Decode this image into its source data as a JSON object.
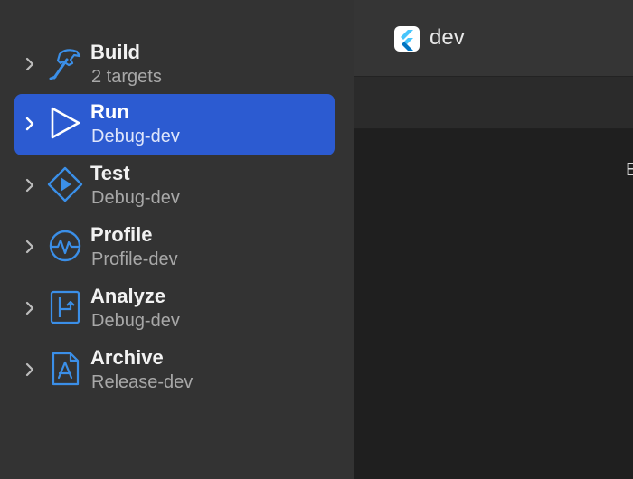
{
  "document": {
    "title": "dev"
  },
  "editor": {
    "edge_text": "E"
  },
  "actions": [
    {
      "label": "Build",
      "detail": "2 targets",
      "icon": "hammer-icon",
      "selected": false
    },
    {
      "label": "Run",
      "detail": "Debug-dev",
      "icon": "play-icon",
      "selected": true
    },
    {
      "label": "Test",
      "detail": "Debug-dev",
      "icon": "test-diamond-icon",
      "selected": false
    },
    {
      "label": "Profile",
      "detail": "Profile-dev",
      "icon": "waveform-gauge-icon",
      "selected": false
    },
    {
      "label": "Analyze",
      "detail": "Debug-dev",
      "icon": "analyze-branch-icon",
      "selected": false
    },
    {
      "label": "Archive",
      "detail": "Release-dev",
      "icon": "app-store-doc-icon",
      "selected": false
    }
  ],
  "colors": {
    "selection": "#2c5bd1",
    "icon_blue": "#3b8fe8",
    "sidebar_bg": "#333333",
    "content_bg": "#1f1f1f"
  }
}
